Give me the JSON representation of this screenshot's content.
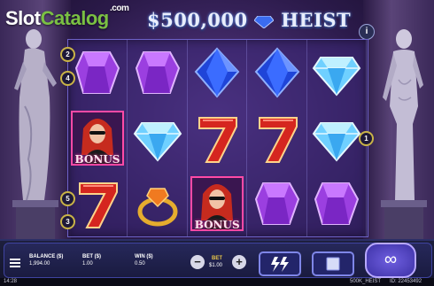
{
  "watermark": {
    "slot": "Slot",
    "catalog": "Catalog",
    "com": ".com"
  },
  "logo": {
    "left": "$500,000",
    "right": "HEIST"
  },
  "info_label": "i",
  "reels": [
    [
      "purple-gem",
      "bonus-lady",
      "red-seven"
    ],
    [
      "purple-gem",
      "diamond",
      "gold-ring"
    ],
    [
      "blue-gem",
      "red-seven",
      "bonus-lady"
    ],
    [
      "blue-gem",
      "red-seven",
      "purple-gem"
    ],
    [
      "diamond",
      "diamond",
      "purple-gem"
    ]
  ],
  "bonus_text": "BONUS",
  "lines_left": [
    "2",
    "4",
    "5",
    "3"
  ],
  "lines_right": [
    "1"
  ],
  "bottom": {
    "balance_label": "BALANCE ($)",
    "balance_value": "1,994.00",
    "bet_label": "BET ($)",
    "bet_value": "1.00",
    "win_label": "WIN ($)",
    "win_value": "0.50",
    "center_bet_label": "BET",
    "center_bet_value": "$1.00",
    "minus": "−",
    "plus": "+",
    "spin_symbol": "∞"
  },
  "footer": {
    "time": "14:28",
    "game": "500K_HEIST",
    "id": "ID: 22453492"
  },
  "colors": {
    "accent": "#7f86e8",
    "gold": "#e8c64a",
    "purple": "#a24be0",
    "blue": "#2a55e0",
    "red": "#d5261f"
  }
}
